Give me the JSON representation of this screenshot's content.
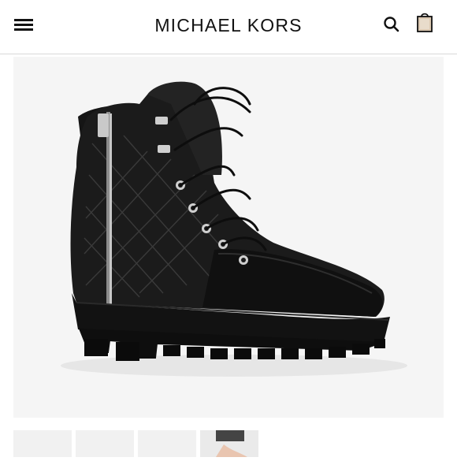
{
  "header": {
    "brand": "MICHAEL KORS",
    "menu_icon": "hamburger-menu-icon",
    "search_icon": "search-icon",
    "bag_icon": "shopping-bag-icon"
  },
  "product": {
    "image": "black-quilted-leather-combat-boot"
  },
  "thumbnails": [
    {
      "id": "thumb-1"
    },
    {
      "id": "thumb-2"
    },
    {
      "id": "thumb-3"
    },
    {
      "id": "thumb-4"
    }
  ],
  "colors": {
    "text": "#111111",
    "divider": "#d8d8d8",
    "image_bg": "#f5f5f5",
    "bag_fill": "#dcc9b2"
  }
}
